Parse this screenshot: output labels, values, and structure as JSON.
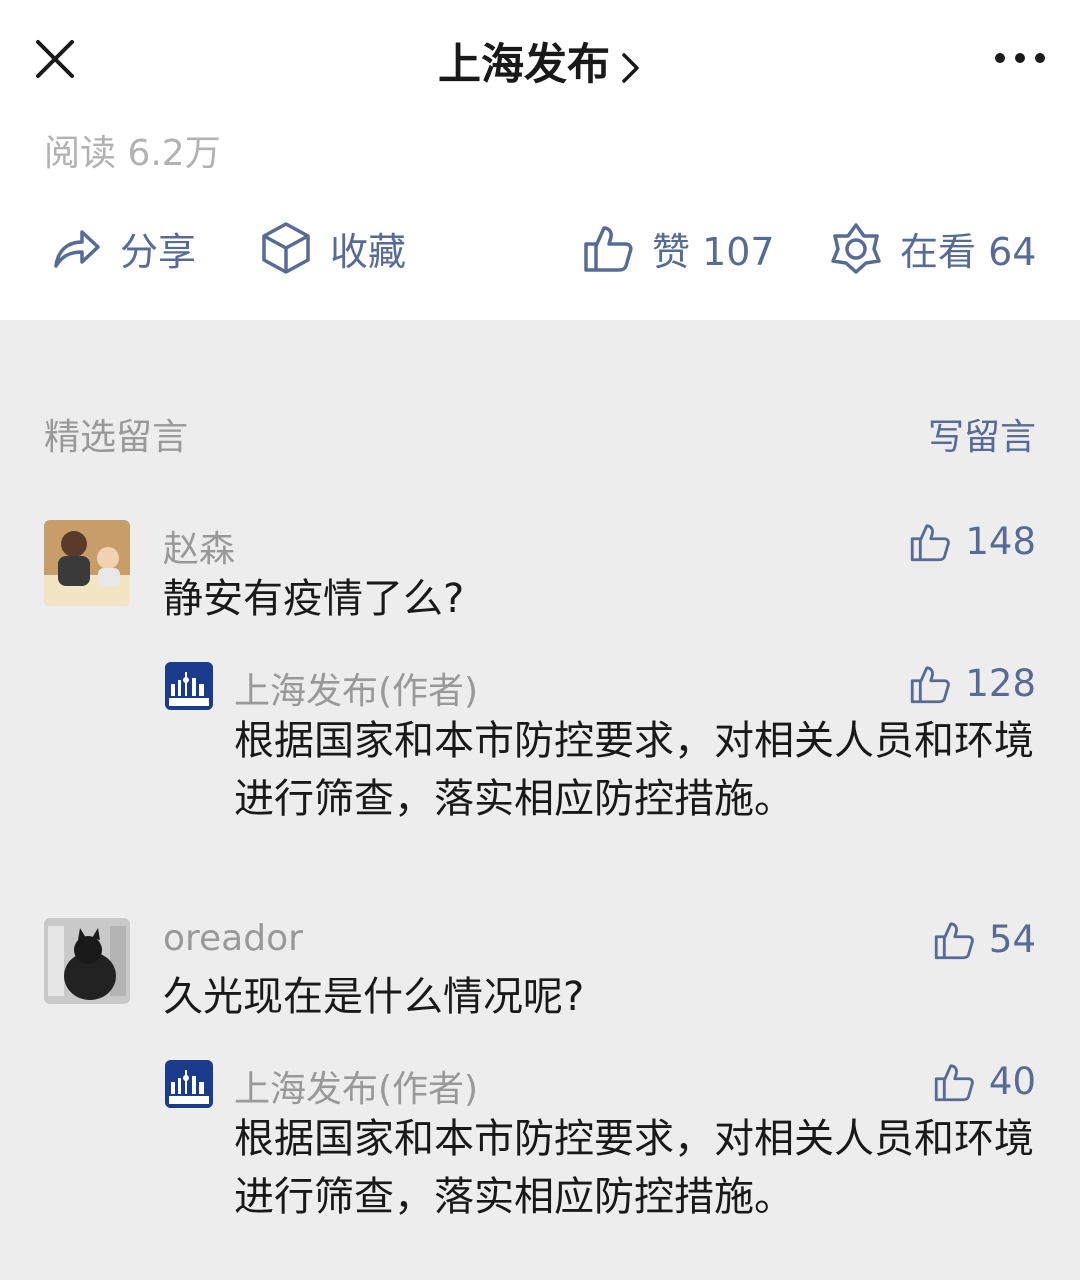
{
  "header": {
    "title": "上海发布",
    "read_count": "阅读 6.2万"
  },
  "actions": {
    "share": "分享",
    "favorite": "收藏",
    "like": "赞 107",
    "watching": "在看 64"
  },
  "comments_section": {
    "title": "精选留言",
    "write_label": "写留言"
  },
  "comments": [
    {
      "name": "赵森",
      "text": "静安有疫情了么?",
      "likes": "148",
      "reply": {
        "name": "上海发布(作者)",
        "text": "根据国家和本市防控要求，对相关人员和环境进行筛查，落实相应防控措施。",
        "likes": "128"
      }
    },
    {
      "name": "oreador",
      "text": "久光现在是什么情况呢?",
      "likes": "54",
      "reply": {
        "name": "上海发布(作者)",
        "text": "根据国家和本市防控要求，对相关人员和环境进行筛查，落实相应防控措施。",
        "likes": "40"
      }
    }
  ],
  "icons": {
    "close": "close-icon",
    "chevron": "chevron-right-icon",
    "more": "more-icon",
    "share": "share-icon",
    "favorite": "cube-icon",
    "like": "thumbs-up-icon",
    "watching": "star-icon"
  },
  "colors": {
    "link": "#576b95",
    "muted": "#999999",
    "background": "#ededed"
  }
}
